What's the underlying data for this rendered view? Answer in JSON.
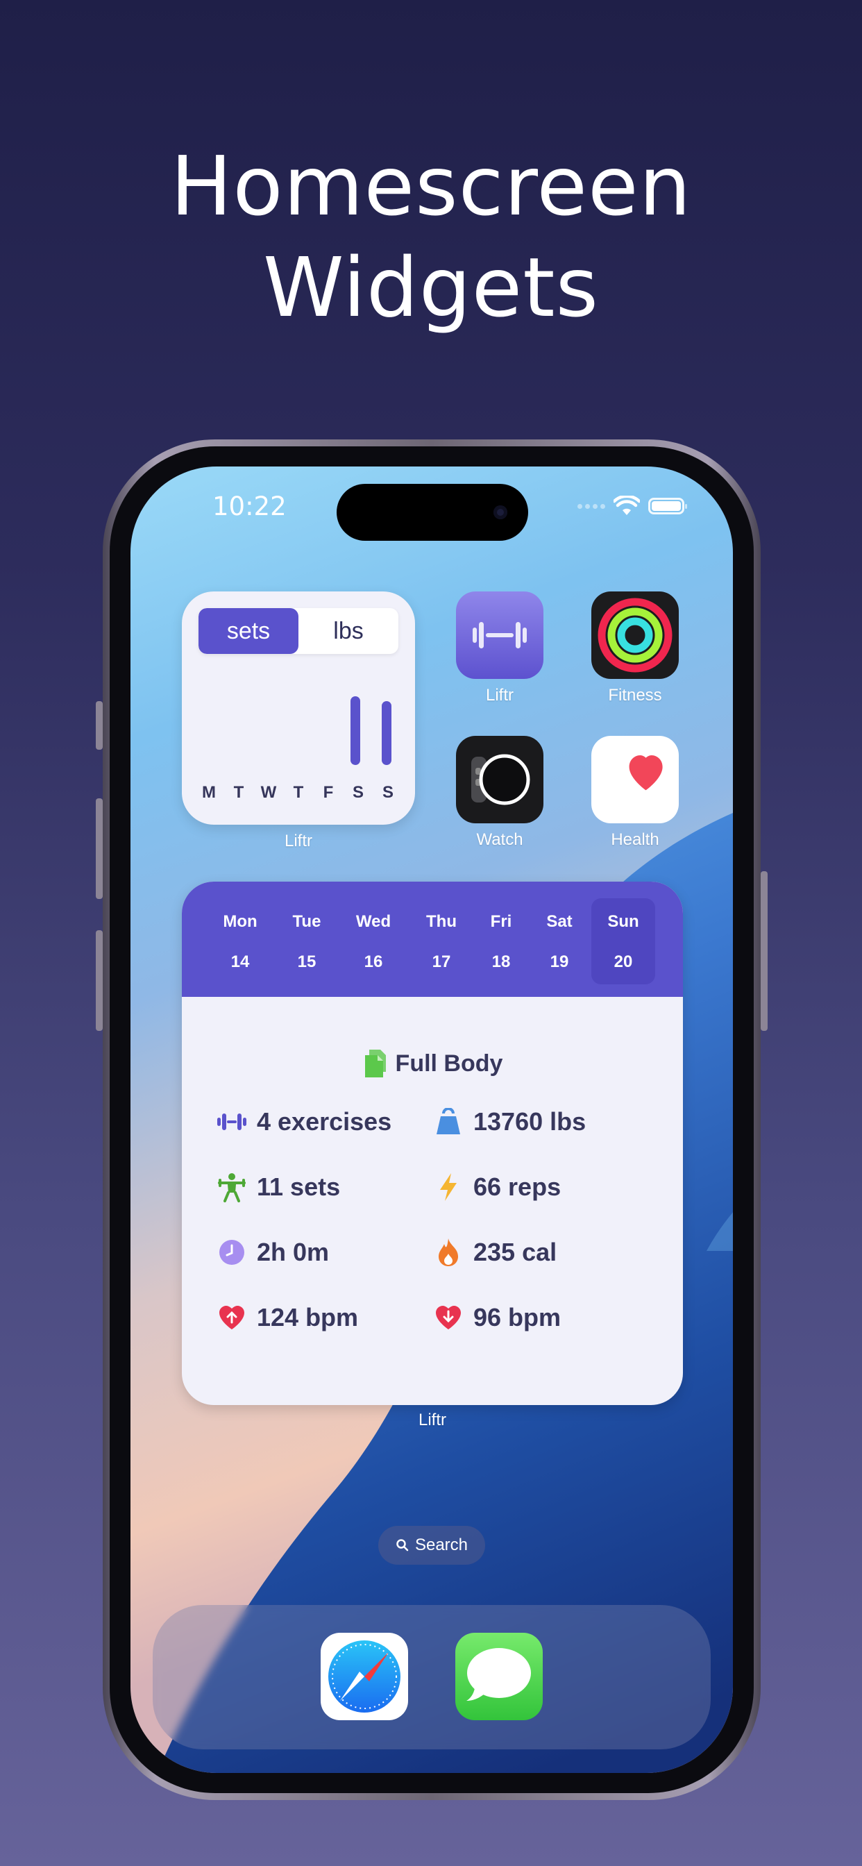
{
  "headline": {
    "line1": "Homescreen",
    "line2": "Widgets"
  },
  "status_bar": {
    "time": "10:22"
  },
  "small_widget": {
    "segments": [
      {
        "label": "sets",
        "active": true
      },
      {
        "label": "lbs",
        "active": false
      }
    ],
    "days": [
      "M",
      "T",
      "W",
      "T",
      "F",
      "S",
      "S"
    ],
    "day_values": [
      0,
      0,
      0,
      0,
      0,
      0.95,
      0.88
    ],
    "label": "Liftr"
  },
  "apps": {
    "liftr": {
      "label": "Liftr",
      "icon": "dumbbell-icon"
    },
    "fitness": {
      "label": "Fitness",
      "icon": "activity-rings-icon"
    },
    "watch": {
      "label": "Watch",
      "icon": "watch-icon"
    },
    "health": {
      "label": "Health",
      "icon": "heart-icon"
    }
  },
  "workout_widget": {
    "calendar": [
      {
        "name": "Mon",
        "date": "14"
      },
      {
        "name": "Tue",
        "date": "15"
      },
      {
        "name": "Wed",
        "date": "16"
      },
      {
        "name": "Thu",
        "date": "17"
      },
      {
        "name": "Fri",
        "date": "18"
      },
      {
        "name": "Sat",
        "date": "19"
      },
      {
        "name": "Sun",
        "date": "20",
        "selected": true
      }
    ],
    "title": "Full Body",
    "stats": {
      "exercises": "4 exercises",
      "weight": "13760 lbs",
      "sets": "11 sets",
      "reps": "66 reps",
      "duration": "2h 0m",
      "calories": "235 cal",
      "max_hr": "124 bpm",
      "min_hr": "96 bpm"
    },
    "label": "Liftr"
  },
  "search": {
    "label": "Search"
  },
  "dock": {
    "apps": [
      "safari-icon",
      "messages-icon"
    ]
  },
  "colors": {
    "accent": "#5a52cc",
    "text": "#37375c",
    "widget_bg": "#f1f1fa"
  }
}
